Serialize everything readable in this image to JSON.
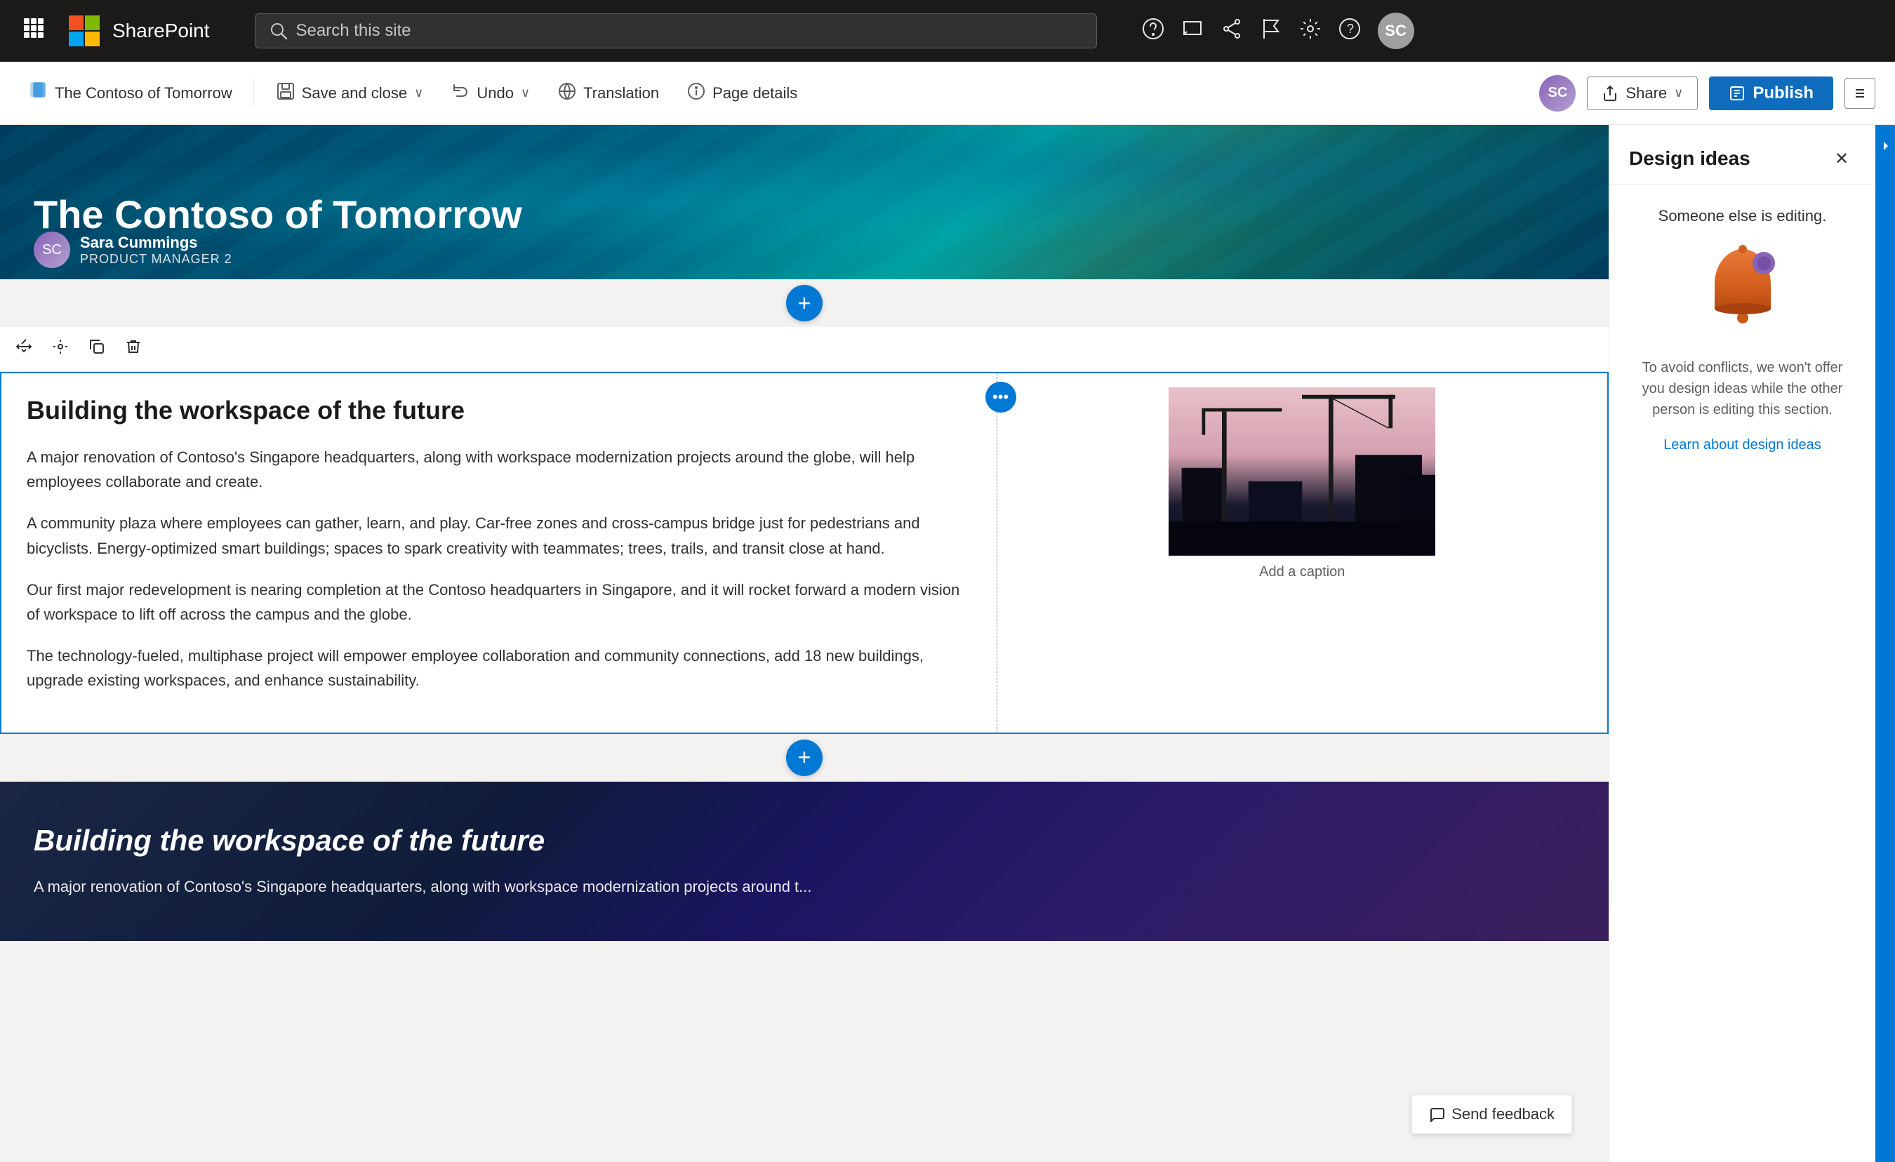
{
  "topnav": {
    "app_name": "Microsoft",
    "sharepoint": "SharePoint",
    "search_placeholder": "Search this site"
  },
  "toolbar": {
    "page_label": "The Contoso of Tomorrow",
    "save_close": "Save and close",
    "undo": "Undo",
    "translation": "Translation",
    "page_details": "Page details",
    "share": "Share",
    "publish": "Publish"
  },
  "hero": {
    "title": "The Contoso of Tomorrow",
    "author_name": "Sara Cummings",
    "author_title": "Product Manager 2"
  },
  "content": {
    "heading": "Building the workspace of the future",
    "para1": "A major renovation of Contoso's Singapore headquarters, along with workspace modernization projects around the globe, will help employees collaborate and create.",
    "para2": "A community plaza where employees can gather, learn, and play. Car-free zones and cross-campus bridge just for pedestrians and bicyclists. Energy-optimized smart buildings; spaces to spark creativity with teammates; trees, trails, and transit close at hand.",
    "para3": "Our first major redevelopment is nearing completion at the Contoso headquarters in Singapore, and it will rocket forward a modern vision of workspace to lift off across the campus and the globe.",
    "para4": "The technology-fueled, multiphase project will empower employee collaboration and community connections, add 18 new buildings, upgrade existing workspaces, and enhance sustainability.",
    "image_caption": "Add a caption"
  },
  "dark_section": {
    "heading": "Building the workspace of the future",
    "para1": "A major renovation of Contoso's Singapore headquarters, along with workspace modernization projects around t..."
  },
  "design_panel": {
    "title": "Design ideas",
    "status": "Someone else is editing.",
    "description": "To avoid conflicts, we won't offer you design ideas while the other person is editing this section.",
    "link": "Learn about design ideas"
  },
  "feedback": {
    "label": "Send feedback"
  },
  "icons": {
    "waffle": "⊞",
    "search": "🔍",
    "close": "✕",
    "plus": "+",
    "save": "💾",
    "undo": "↩",
    "translation": "🌐",
    "gear": "⚙",
    "share_icon": "↑",
    "publish_icon": "📋"
  }
}
